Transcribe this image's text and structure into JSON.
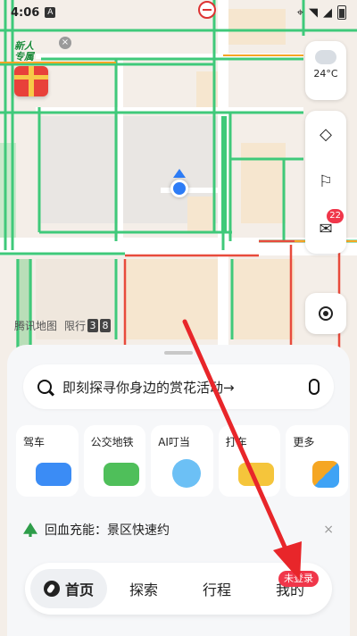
{
  "status": {
    "time": "4:06",
    "left_icon": "A"
  },
  "newcomer": {
    "text_line1": "新人",
    "text_line2": "专属",
    "close": "×"
  },
  "weather": {
    "temp": "24°C",
    "icon": "cloud-icon"
  },
  "right_controls": {
    "layers_icon": "layers-icon",
    "feedback_icon": "feedback-icon",
    "message_icon": "mail-icon",
    "message_badge": "22",
    "locate_icon": "locate-icon"
  },
  "map": {
    "watermark": "腾讯地图",
    "limit_label": "限行",
    "limit_num_1": "3",
    "limit_num_2": "8"
  },
  "search": {
    "placeholder": "即刻探寻你身边的赏花活动→"
  },
  "shortcuts": [
    {
      "label": "驾车",
      "color": "#3b8cf5"
    },
    {
      "label": "公交地铁",
      "color": "#4fbf5a"
    },
    {
      "label": "AI叮当",
      "color": "#6cc0f5"
    },
    {
      "label": "打车",
      "color": "#f5c53b"
    },
    {
      "label": "更多",
      "color": "#3fa3f5"
    }
  ],
  "promo": {
    "text": "回血充能：景区快速约",
    "close": "×"
  },
  "tabs": {
    "home": "首页",
    "explore": "探索",
    "trip": "行程",
    "mine": "我的"
  },
  "login_badge": "未登录"
}
